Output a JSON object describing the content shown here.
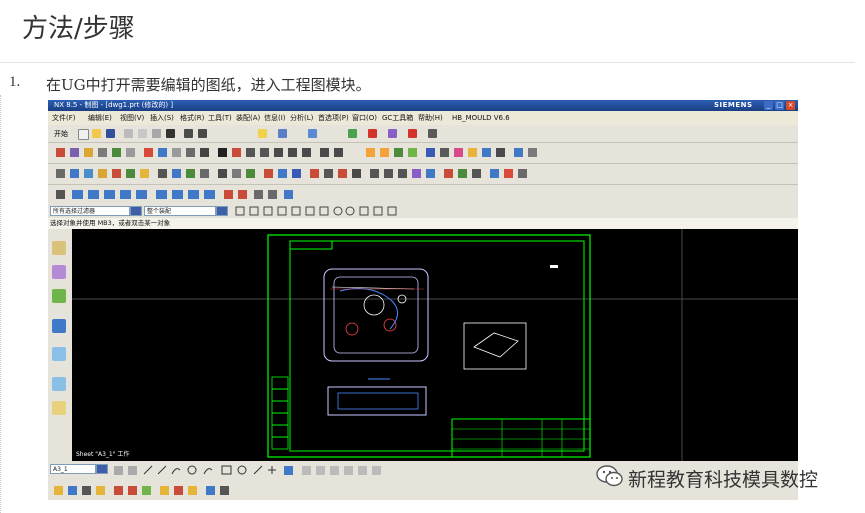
{
  "section": {
    "title": "方法/步骤"
  },
  "step": {
    "number": "1.",
    "text": "在UG中打开需要编辑的图纸，进入工程图模块。"
  },
  "screenshot": {
    "window_title": "NX 8.5 - 制图 - [dwg1.prt (修改的) ]",
    "brand": "SIEMENS",
    "menu": [
      "文件(F)",
      "编辑(E)",
      "视图(V)",
      "插入(S)",
      "格式(R)",
      "工具(T)",
      "装配(A)",
      "信息(I)",
      "分析(L)",
      "首选项(P)",
      "窗口(O)",
      "GC工具箱",
      "帮助(H)",
      "HB_MOULD V6.6"
    ],
    "start_label": "开始",
    "filter_value": "所有选择过滤器",
    "scope_value": "整个装配",
    "status_text": "选择对象并使用 MB3，或者双击某一对象",
    "sheet_label": "Sheet \"A3_1\" 工作",
    "sheet_select_value": "A3_1",
    "colors": {
      "drawing_green": "#00ff00",
      "canvas_bg": "#000000",
      "titlebar": "#1f4a9a"
    }
  },
  "watermark": {
    "text": "新程教育科技模具数控"
  }
}
